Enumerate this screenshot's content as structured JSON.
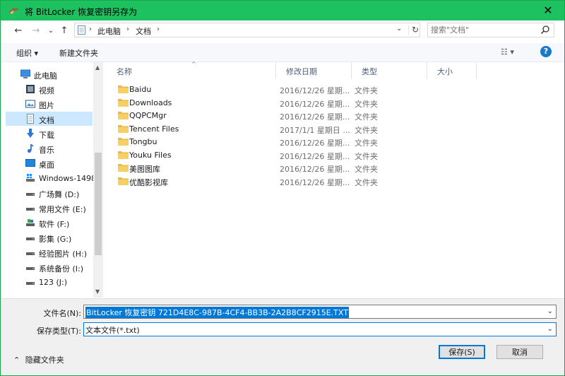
{
  "window": {
    "title": "将 BitLocker 恢复密钥另存为",
    "close_glyph": "✕",
    "accent_color": "#1ec15f"
  },
  "nav_buttons": {
    "back": "←",
    "forward": "→",
    "recent": "⌄",
    "up": "↑"
  },
  "address": {
    "crumbs": [
      "此电脑",
      "文档"
    ],
    "separator": "›"
  },
  "search": {
    "placeholder": "搜索\"文档\""
  },
  "toolbar": {
    "organize_label": "组织 ▾",
    "new_folder_label": "新建文件夹",
    "view_label": "☷ ▾",
    "help_label": "?"
  },
  "nav_pane": {
    "items": [
      {
        "label": "此电脑",
        "icon": "computer-icon",
        "level": "top"
      },
      {
        "label": "视频",
        "icon": "video-icon"
      },
      {
        "label": "图片",
        "icon": "picture-icon"
      },
      {
        "label": "文档",
        "icon": "document-icon",
        "selected": true
      },
      {
        "label": "下载",
        "icon": "download-icon"
      },
      {
        "label": "音乐",
        "icon": "music-icon"
      },
      {
        "label": "桌面",
        "icon": "desktop-icon"
      },
      {
        "label": "Windows-1498",
        "icon": "windows-drive-icon"
      },
      {
        "label": "广场舞 (D:)",
        "icon": "drive-icon"
      },
      {
        "label": "常用文件 (E:)",
        "icon": "drive-icon"
      },
      {
        "label": "软件  (F:)",
        "icon": "software-drive-icon"
      },
      {
        "label": "影集 (G:)",
        "icon": "drive-icon"
      },
      {
        "label": "经验图片 (H:)",
        "icon": "drive-icon"
      },
      {
        "label": "系统备份 (I:)",
        "icon": "drive-icon"
      },
      {
        "label": "123 (J:)",
        "icon": "drive-icon"
      }
    ]
  },
  "file_list": {
    "columns": [
      "名称",
      "修改日期",
      "类型",
      "大小"
    ],
    "rows": [
      {
        "name": "Baidu",
        "date": "2016/12/26 星期...",
        "type": "文件夹"
      },
      {
        "name": "Downloads",
        "date": "2016/12/26 星期...",
        "type": "文件夹"
      },
      {
        "name": "QQPCMgr",
        "date": "2016/12/26 星期...",
        "type": "文件夹"
      },
      {
        "name": "Tencent Files",
        "date": "2017/1/1 星期日 ...",
        "type": "文件夹"
      },
      {
        "name": "Tongbu",
        "date": "2016/12/26 星期...",
        "type": "文件夹"
      },
      {
        "name": "Youku Files",
        "date": "2016/12/26 星期...",
        "type": "文件夹"
      },
      {
        "name": "美图图库",
        "date": "2016/12/26 星期...",
        "type": "文件夹"
      },
      {
        "name": "优酷影视库",
        "date": "2016/12/26 星期...",
        "type": "文件夹"
      }
    ]
  },
  "save_form": {
    "filename_label": "文件名(N):",
    "filename_value": "BitLocker 恢复密钥 721D4E8C-987B-4CF4-BB3B-2A2B8CF2915E.TXT",
    "filetype_label": "保存类型(T):",
    "filetype_value": "文本文件(*.txt)",
    "hide_folders_label": "隐藏文件夹",
    "save_label": "保存(S)",
    "cancel_label": "取消"
  }
}
